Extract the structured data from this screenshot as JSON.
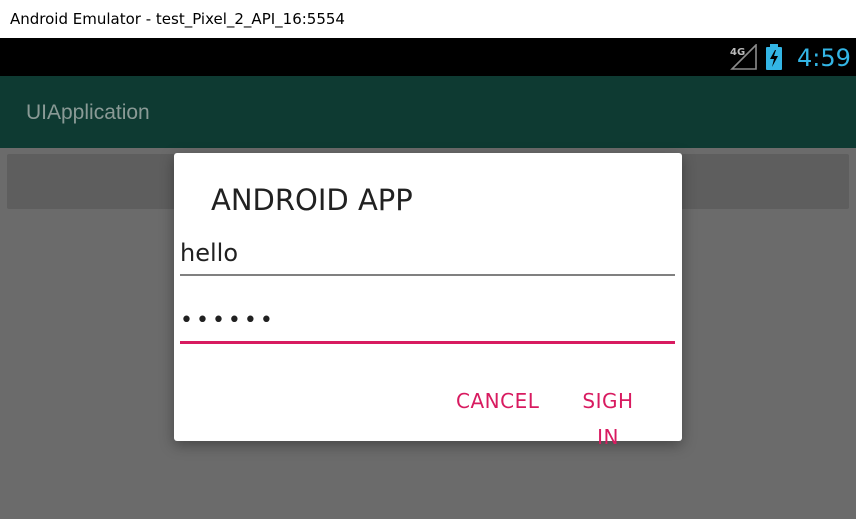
{
  "window": {
    "title": "Android Emulator - test_Pixel_2_API_16:5554"
  },
  "status_bar": {
    "network_label": "4G",
    "time": "4:59",
    "icons": [
      "signal-icon",
      "battery-charging-icon"
    ],
    "time_color": "#33b5e5"
  },
  "action_bar": {
    "title": "UIApplication",
    "background_color": "#0e3a32"
  },
  "dialog": {
    "title": "ANDROID APP",
    "username_value": "hello",
    "password_value": "123456",
    "cancel_label": "CANCEL",
    "sign_in_label": "SIGH IN",
    "accent_color": "#d81b60"
  }
}
